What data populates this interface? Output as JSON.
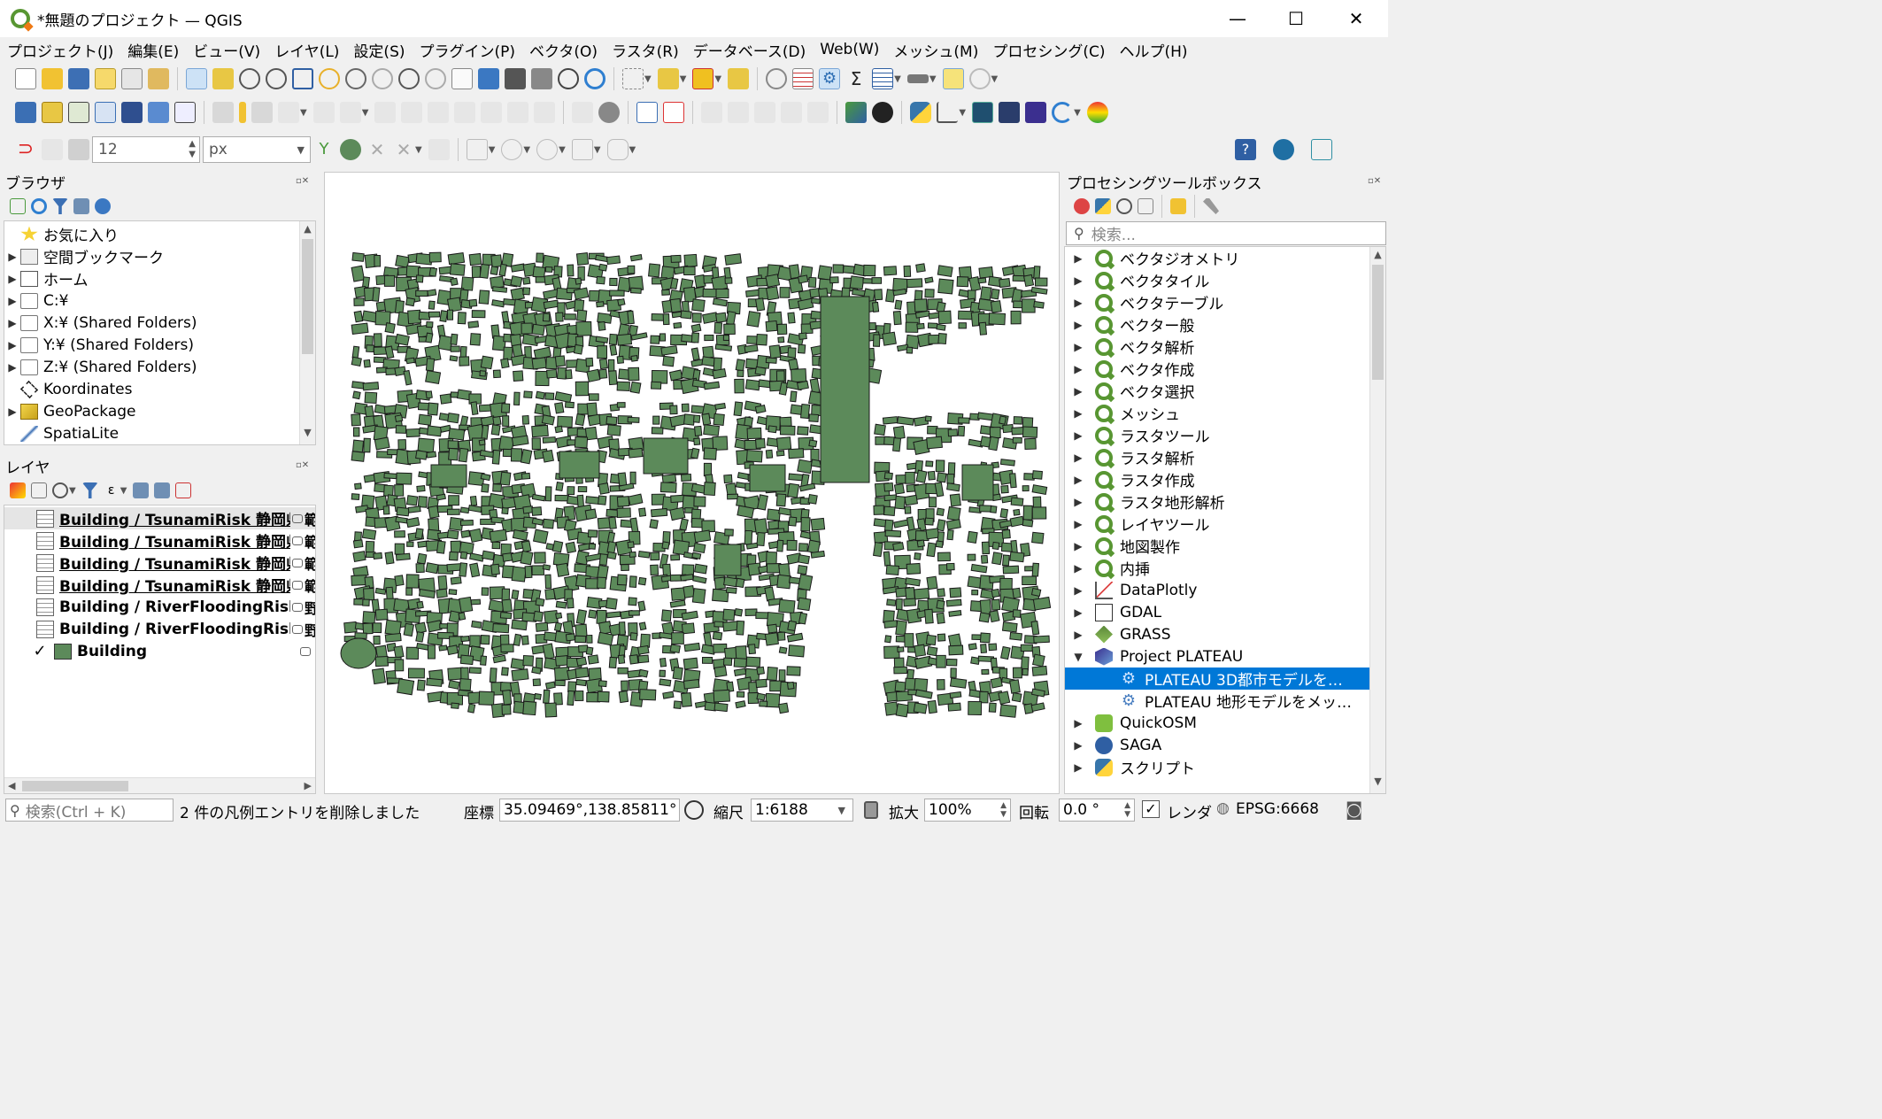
{
  "window": {
    "title": "*無題のプロジェクト — QGIS",
    "minimize": "—",
    "maximize": "☐",
    "close": "✕"
  },
  "menu": [
    "プロジェクト(J)",
    "編集(E)",
    "ビュー(V)",
    "レイヤ(L)",
    "設定(S)",
    "プラグイン(P)",
    "ベクタ(O)",
    "ラスタ(R)",
    "データベース(D)",
    "Web(W)",
    "メッシュ(M)",
    "プロセシング(C)",
    "ヘルプ(H)"
  ],
  "digitizing": {
    "tolerance_value": "12",
    "unit": "px"
  },
  "browser": {
    "title": "ブラウザ",
    "items": [
      {
        "label": "お気に入り",
        "icon": "star-icon",
        "expand": ""
      },
      {
        "label": "空間ブックマーク",
        "icon": "bookmark-icon",
        "expand": "▶"
      },
      {
        "label": "ホーム",
        "icon": "home-icon",
        "expand": "▶"
      },
      {
        "label": "C:¥",
        "icon": "folder-icon",
        "expand": "▶"
      },
      {
        "label": "X:¥ (Shared Folders)",
        "icon": "folder-icon",
        "expand": "▶"
      },
      {
        "label": "Y:¥ (Shared Folders)",
        "icon": "folder-icon",
        "expand": "▶"
      },
      {
        "label": "Z:¥ (Shared Folders)",
        "icon": "folder-icon",
        "expand": "▶"
      },
      {
        "label": "Koordinates",
        "icon": "koordinates-icon",
        "expand": ""
      },
      {
        "label": "GeoPackage",
        "icon": "geopackage-icon",
        "expand": "▶"
      },
      {
        "label": "SpatiaLite",
        "icon": "spatialite-icon",
        "expand": ""
      }
    ]
  },
  "layers": {
    "title": "レイヤ",
    "items": [
      {
        "label": "Building / TsunamiRisk 静岡県",
        "suffix": "範"
      },
      {
        "label": "Building / TsunamiRisk 静岡県",
        "suffix": "範"
      },
      {
        "label": "Building / TsunamiRisk 静岡県",
        "suffix": "範"
      },
      {
        "label": "Building / TsunamiRisk 静岡県",
        "suffix": "範"
      },
      {
        "label": "Building / RiverFloodingRisk",
        "suffix": "野"
      },
      {
        "label": "Building / RiverFloodingRisk",
        "suffix": "野"
      }
    ],
    "building_layer": {
      "label": "Building",
      "checked": "✓",
      "fill_color": "#5c8a5a"
    }
  },
  "processing": {
    "title": "プロセシングツールボックス",
    "search_placeholder": "検索...",
    "items": [
      {
        "label": "ベクタジオメトリ",
        "icon": "qgis-icon",
        "expand": "▶"
      },
      {
        "label": "ベクタタイル",
        "icon": "qgis-icon",
        "expand": "▶"
      },
      {
        "label": "ベクタテーブル",
        "icon": "qgis-icon",
        "expand": "▶"
      },
      {
        "label": "ベクター般",
        "icon": "qgis-icon",
        "expand": "▶"
      },
      {
        "label": "ベクタ解析",
        "icon": "qgis-icon",
        "expand": "▶"
      },
      {
        "label": "ベクタ作成",
        "icon": "qgis-icon",
        "expand": "▶"
      },
      {
        "label": "ベクタ選択",
        "icon": "qgis-icon",
        "expand": "▶"
      },
      {
        "label": "メッシュ",
        "icon": "qgis-icon",
        "expand": "▶"
      },
      {
        "label": "ラスタツール",
        "icon": "qgis-icon",
        "expand": "▶"
      },
      {
        "label": "ラスタ解析",
        "icon": "qgis-icon",
        "expand": "▶"
      },
      {
        "label": "ラスタ作成",
        "icon": "qgis-icon",
        "expand": "▶"
      },
      {
        "label": "ラスタ地形解析",
        "icon": "qgis-icon",
        "expand": "▶"
      },
      {
        "label": "レイヤツール",
        "icon": "qgis-icon",
        "expand": "▶"
      },
      {
        "label": "地図製作",
        "icon": "qgis-icon",
        "expand": "▶"
      },
      {
        "label": "内挿",
        "icon": "qgis-icon",
        "expand": "▶"
      },
      {
        "label": "DataPlotly",
        "icon": "dataplotly-icon",
        "expand": "▶"
      },
      {
        "label": "GDAL",
        "icon": "gdal-icon",
        "expand": "▶"
      },
      {
        "label": "GRASS",
        "icon": "grass-icon",
        "expand": "▶"
      },
      {
        "label": "Project PLATEAU",
        "icon": "plateau-icon",
        "expand": "▼"
      },
      {
        "label": "PLATEAU 3D都市モデルを…",
        "icon": "gear-icon",
        "expand": ""
      },
      {
        "label": "PLATEAU 地形モデルをメッ…",
        "icon": "gear-icon",
        "expand": ""
      },
      {
        "label": "QuickOSM",
        "icon": "quickosm-icon",
        "expand": "▶"
      },
      {
        "label": "SAGA",
        "icon": "saga-icon",
        "expand": "▶"
      },
      {
        "label": "スクリプト",
        "icon": "python-icon",
        "expand": "▶"
      }
    ],
    "selected_index": 19
  },
  "status": {
    "search_placeholder": "検索(Ctrl + K)",
    "message": "2 件の凡例エントリを削除しました",
    "coord_label": "座標",
    "coord_value": "35.09469°,138.85811°",
    "scale_label": "縮尺",
    "scale_value": "1:6188",
    "magnifier_label": "拡大",
    "magnifier_value": "100%",
    "rotation_label": "回転",
    "rotation_value": "0.0 °",
    "render_label": "レンダ",
    "crs": "EPSG:6668"
  }
}
